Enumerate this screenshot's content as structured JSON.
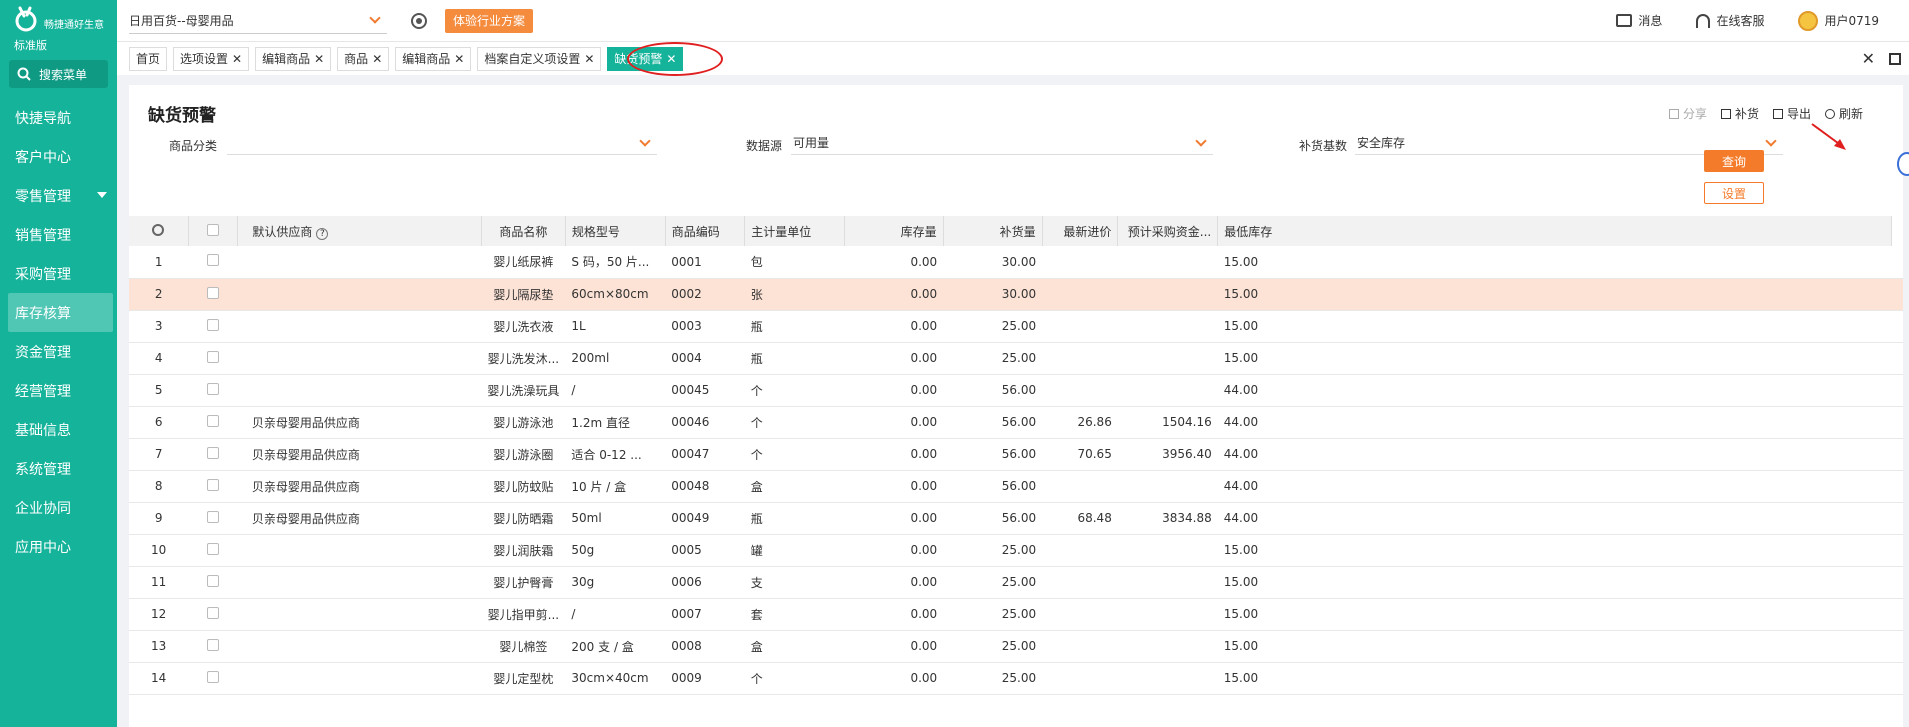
{
  "sidebar": {
    "logo_text": "畅捷通好生意",
    "edition": "标准版",
    "search_label": "搜索菜单",
    "items": [
      {
        "label": "快捷导航"
      },
      {
        "label": "客户中心"
      },
      {
        "label": "零售管理"
      },
      {
        "label": "销售管理"
      },
      {
        "label": "采购管理"
      },
      {
        "label": "库存核算"
      },
      {
        "label": "资金管理"
      },
      {
        "label": "经营管理"
      },
      {
        "label": "基础信息"
      },
      {
        "label": "系统管理"
      },
      {
        "label": "企业协同"
      },
      {
        "label": "应用中心"
      }
    ]
  },
  "topbar": {
    "industry": "日用百货--母婴用品",
    "experience_btn": "体验行业方案",
    "messages": "消息",
    "support": "在线客服",
    "user": "用户0719"
  },
  "tabs": [
    {
      "label": "首页",
      "closable": false
    },
    {
      "label": "选项设置",
      "closable": true
    },
    {
      "label": "编辑商品",
      "closable": true
    },
    {
      "label": "商品",
      "closable": true
    },
    {
      "label": "编辑商品",
      "closable": true
    },
    {
      "label": "档案自定义项设置",
      "closable": true
    },
    {
      "label": "缺货预警",
      "closable": true,
      "active": true
    }
  ],
  "tabs_close_all": "✕",
  "page": {
    "title": "缺货预警",
    "actions": {
      "share": "分享",
      "replenish": "补货",
      "export": "导出",
      "refresh": "刷新"
    },
    "filters": {
      "category_label": "商品分类",
      "category_value": "",
      "source_label": "数据源",
      "source_value": "可用量",
      "base_label": "补货基数",
      "base_value": "安全库存"
    },
    "query_btn": "查询",
    "settings_btn": "设置"
  },
  "table": {
    "headers": [
      "默认供应商",
      "商品名称",
      "规格型号",
      "商品编码",
      "主计量单位",
      "库存量",
      "补货量",
      "最新进价",
      "预计采购资金...",
      "最低库存"
    ],
    "rows": [
      [
        "1",
        "",
        "婴儿纸尿裤",
        "S 码，50 片...",
        "0001",
        "包",
        "0.00",
        "30.00",
        "",
        "",
        "15.00"
      ],
      [
        "2",
        "",
        "婴儿隔尿垫",
        "60cm×80cm",
        "0002",
        "张",
        "0.00",
        "30.00",
        "",
        "",
        "15.00"
      ],
      [
        "3",
        "",
        "婴儿洗衣液",
        "1L",
        "0003",
        "瓶",
        "0.00",
        "25.00",
        "",
        "",
        "15.00"
      ],
      [
        "4",
        "",
        "婴儿洗发沐...",
        "200ml",
        "0004",
        "瓶",
        "0.00",
        "25.00",
        "",
        "",
        "15.00"
      ],
      [
        "5",
        "",
        "婴儿洗澡玩具",
        "/",
        "00045",
        "个",
        "0.00",
        "56.00",
        "",
        "",
        "44.00"
      ],
      [
        "6",
        "贝亲母婴用品供应商",
        "婴儿游泳池",
        "1.2m 直径",
        "00046",
        "个",
        "0.00",
        "56.00",
        "26.86",
        "1504.16",
        "44.00"
      ],
      [
        "7",
        "贝亲母婴用品供应商",
        "婴儿游泳圈",
        "适合 0-12 ...",
        "00047",
        "个",
        "0.00",
        "56.00",
        "70.65",
        "3956.40",
        "44.00"
      ],
      [
        "8",
        "贝亲母婴用品供应商",
        "婴儿防蚊贴",
        "10 片 / 盒",
        "00048",
        "盒",
        "0.00",
        "56.00",
        "",
        "",
        "44.00"
      ],
      [
        "9",
        "贝亲母婴用品供应商",
        "婴儿防晒霜",
        "50ml",
        "00049",
        "瓶",
        "0.00",
        "56.00",
        "68.48",
        "3834.88",
        "44.00"
      ],
      [
        "10",
        "",
        "婴儿润肤霜",
        "50g",
        "0005",
        "罐",
        "0.00",
        "25.00",
        "",
        "",
        "15.00"
      ],
      [
        "11",
        "",
        "婴儿护臀膏",
        "30g",
        "0006",
        "支",
        "0.00",
        "25.00",
        "",
        "",
        "15.00"
      ],
      [
        "12",
        "",
        "婴儿指甲剪...",
        "/",
        "0007",
        "套",
        "0.00",
        "25.00",
        "",
        "",
        "15.00"
      ],
      [
        "13",
        "",
        "婴儿棉签",
        "200 支 / 盒",
        "0008",
        "盒",
        "0.00",
        "25.00",
        "",
        "",
        "15.00"
      ],
      [
        "14",
        "",
        "婴儿定型枕",
        "30cm×40cm",
        "0009",
        "个",
        "0.00",
        "25.00",
        "",
        "",
        "15.00"
      ]
    ]
  }
}
